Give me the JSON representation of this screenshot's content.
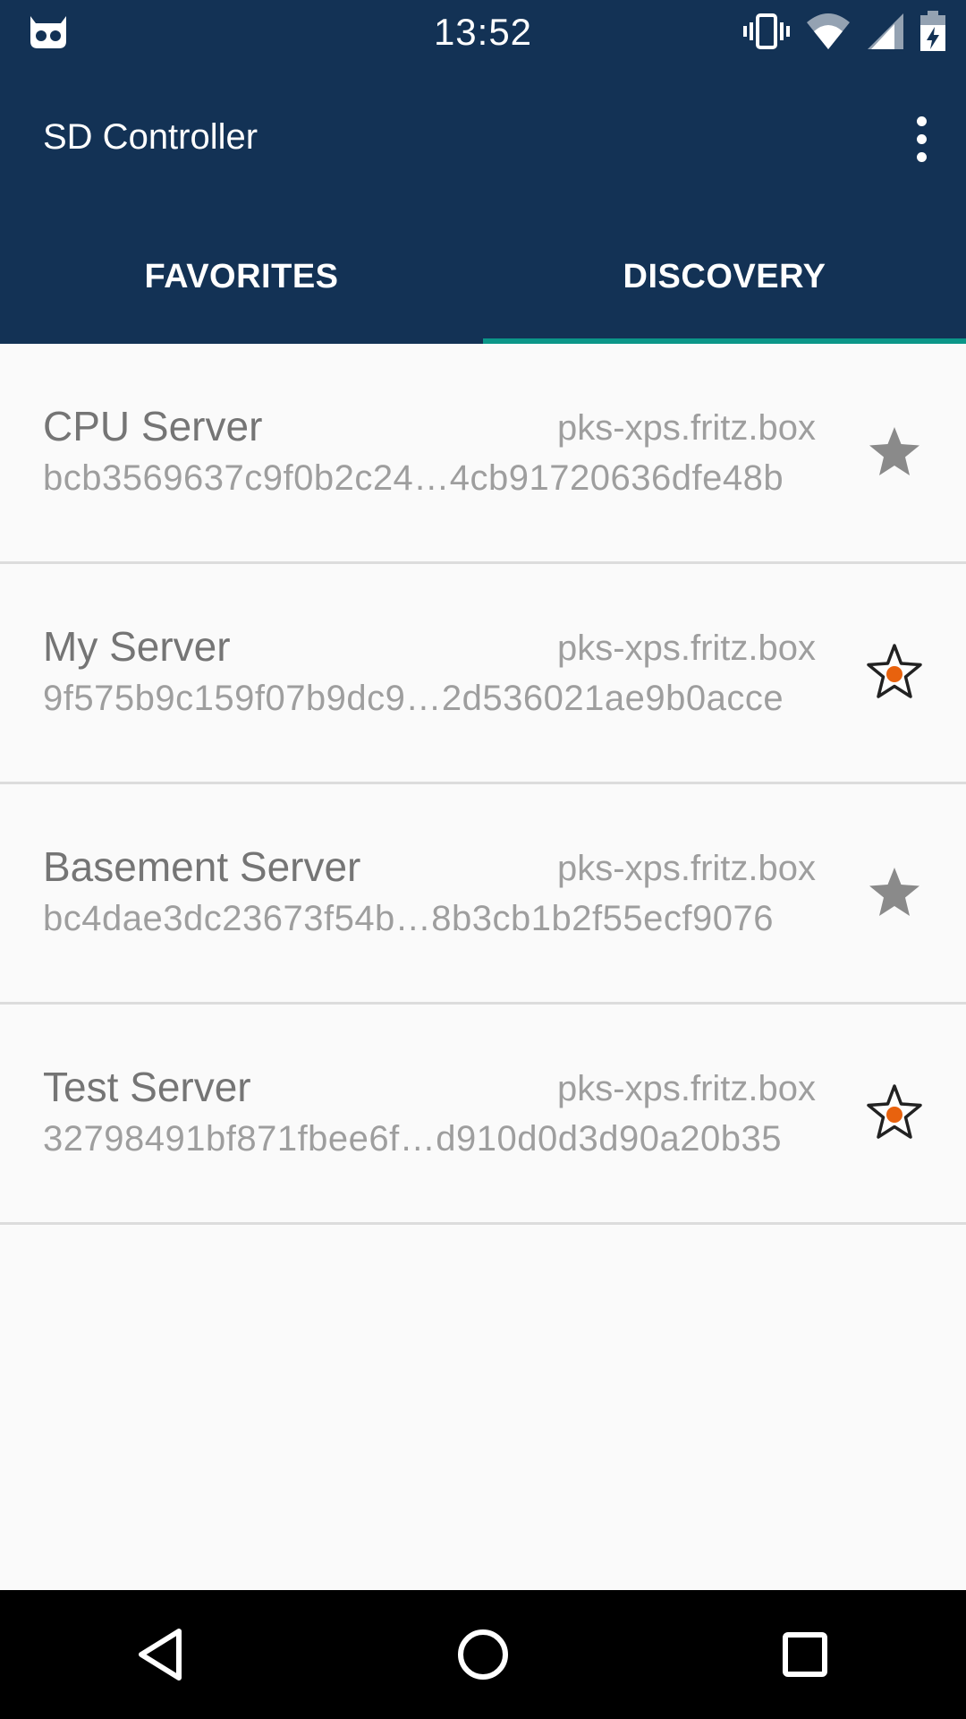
{
  "status_bar": {
    "time": "13:52",
    "icons": [
      "debug-icon",
      "vibrate-icon",
      "wifi-icon",
      "cell-signal-icon",
      "battery-charging-icon"
    ]
  },
  "app_bar": {
    "title": "SD Controller",
    "menu_icon": "overflow-menu-icon"
  },
  "tabs": [
    {
      "label": "FAVORITES",
      "active": false
    },
    {
      "label": "DISCOVERY",
      "active": true
    }
  ],
  "colors": {
    "primary": "#133255",
    "accent": "#0b9688",
    "star_dot": "#e8620e"
  },
  "servers": [
    {
      "name": "CPU Server",
      "host": "pks-xps.fritz.box",
      "id": "bcb3569637c9f0b2c24…4cb91720636dfe48b",
      "favorite": true
    },
    {
      "name": "My Server",
      "host": "pks-xps.fritz.box",
      "id": "9f575b9c159f07b9dc9…2d536021ae9b0acce",
      "favorite": false
    },
    {
      "name": "Basement Server",
      "host": "pks-xps.fritz.box",
      "id": "bc4dae3dc23673f54b…8b3cb1b2f55ecf9076",
      "favorite": true
    },
    {
      "name": "Test Server",
      "host": "pks-xps.fritz.box",
      "id": "32798491bf871fbee6f…d910d0d3d90a20b35",
      "favorite": false
    }
  ],
  "nav_bar": {
    "buttons": [
      "back-icon",
      "home-icon",
      "recents-icon"
    ]
  }
}
